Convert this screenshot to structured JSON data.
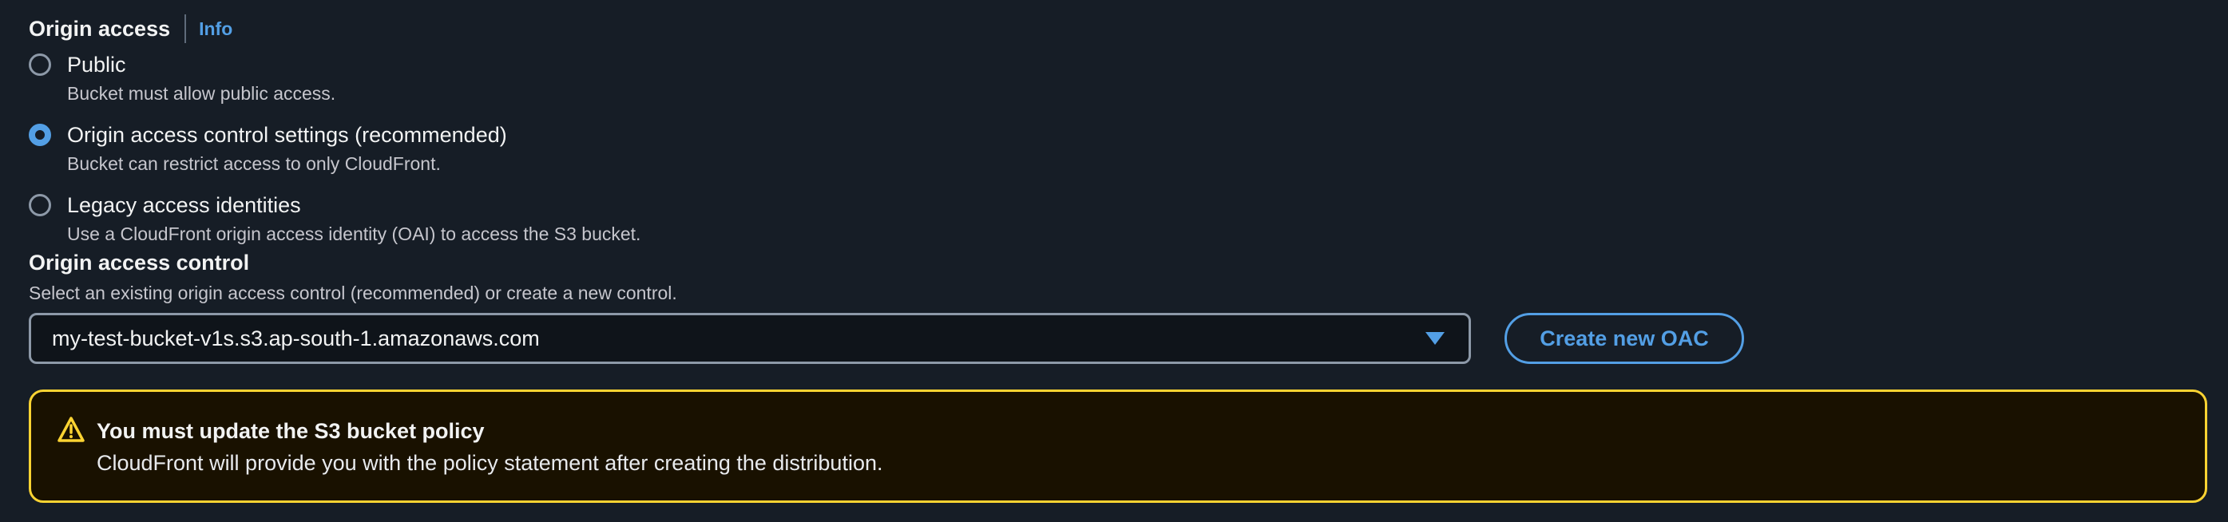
{
  "section": {
    "title": "Origin access",
    "info_label": "Info"
  },
  "radio_options": [
    {
      "label": "Public",
      "description": "Bucket must allow public access.",
      "checked": false
    },
    {
      "label": "Origin access control settings (recommended)",
      "description": "Bucket can restrict access to only CloudFront.",
      "checked": true
    },
    {
      "label": "Legacy access identities",
      "description": "Use a CloudFront origin access identity (OAI) to access the S3 bucket.",
      "checked": false
    }
  ],
  "oac_field": {
    "label": "Origin access control",
    "description": "Select an existing origin access control (recommended) or create a new control.",
    "selected_value": "my-test-bucket-v1s.s3.ap-south-1.amazonaws.com",
    "create_button_label": "Create new OAC"
  },
  "alert": {
    "type": "warning",
    "title": "You must update the S3 bucket policy",
    "body": "CloudFront will provide you with the policy statement after creating the distribution.",
    "icon": "warning-icon"
  },
  "colors": {
    "background": "#161d26",
    "accent": "#539fe5",
    "warning_border": "#fbd332",
    "warning_bg": "#191100"
  }
}
